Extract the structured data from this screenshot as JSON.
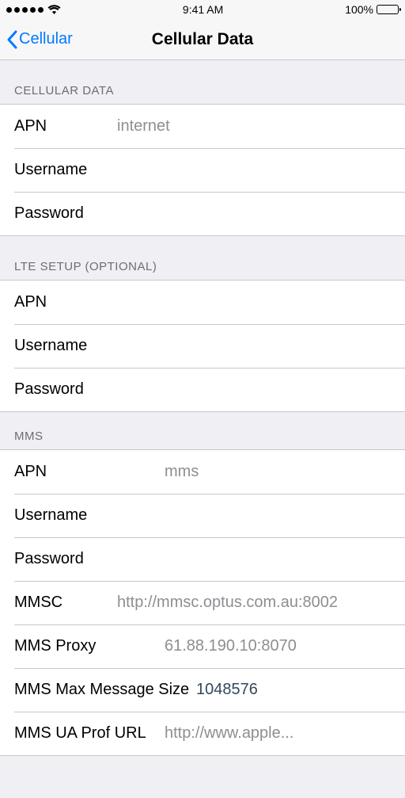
{
  "status": {
    "time": "9:41 AM",
    "battery_pct": "100%"
  },
  "nav": {
    "back_label": "Cellular",
    "title": "Cellular Data"
  },
  "sections": {
    "cellular_data": {
      "header": "CELLULAR DATA",
      "apn_label": "APN",
      "apn_value": "internet",
      "username_label": "Username",
      "username_value": "",
      "password_label": "Password",
      "password_value": ""
    },
    "lte": {
      "header": "LTE SETUP (OPTIONAL)",
      "apn_label": "APN",
      "apn_value": "",
      "username_label": "Username",
      "username_value": "",
      "password_label": "Password",
      "password_value": ""
    },
    "mms": {
      "header": "MMS",
      "apn_label": "APN",
      "apn_value": "mms",
      "username_label": "Username",
      "username_value": "",
      "password_label": "Password",
      "password_value": "",
      "mmsc_label": "MMSC",
      "mmsc_value": "http://mmsc.optus.com.au:8002",
      "proxy_label": "MMS Proxy",
      "proxy_value": "61.88.190.10:8070",
      "max_size_label": "MMS Max Message Size",
      "max_size_value": "1048576",
      "ua_prof_label": "MMS UA Prof URL",
      "ua_prof_value": "http://www.apple..."
    }
  }
}
